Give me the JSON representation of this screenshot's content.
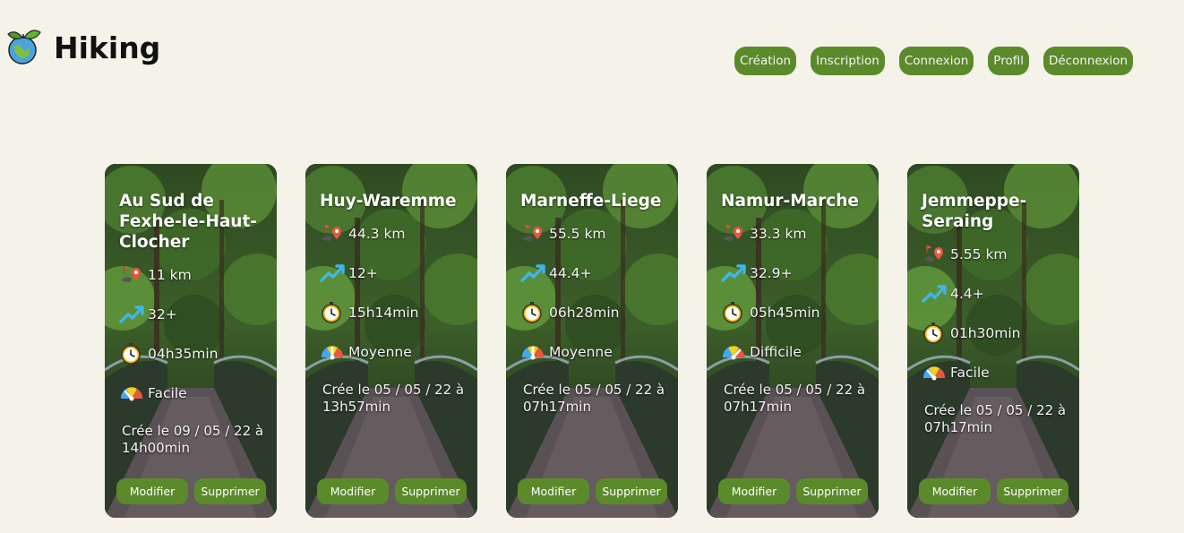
{
  "app": {
    "title": "Hiking"
  },
  "nav": [
    "Création",
    "Inscription",
    "Connexion",
    "Profil",
    "Déconnexion"
  ],
  "actions": {
    "edit": "Modifier",
    "delete": "Supprimer"
  },
  "hikes": [
    {
      "title": "Au Sud de Fexhe-le-Haut-Clocher",
      "distance": "11 km",
      "elevation": "32+",
      "duration": "04h35min",
      "difficulty": "Facile",
      "difficulty_level": "easy",
      "created": "Crée le 09 / 05 / 22 à 14h00min"
    },
    {
      "title": "Huy-Waremme",
      "distance": "44.3 km",
      "elevation": "12+",
      "duration": "15h14min",
      "difficulty": "Moyenne",
      "difficulty_level": "medium",
      "created": "Crée le 05 / 05 / 22 à 13h57min"
    },
    {
      "title": "Marneffe-Liege",
      "distance": "55.5 km",
      "elevation": "44.4+",
      "duration": "06h28min",
      "difficulty": "Moyenne",
      "difficulty_level": "medium",
      "created": "Crée le 05 / 05 / 22 à 07h17min"
    },
    {
      "title": "Namur-Marche",
      "distance": "33.3 km",
      "elevation": "32.9+",
      "duration": "05h45min",
      "difficulty": "Difficile",
      "difficulty_level": "hard",
      "created": "Crée le 05 / 05 / 22 à 07h17min"
    },
    {
      "title": "Jemmeppe-Seraing",
      "distance": "5.55 km",
      "elevation": "4.4+",
      "duration": "01h30min",
      "difficulty": "Facile",
      "difficulty_level": "easy",
      "created": "Crée le 05 / 05 / 22 à 07h17min"
    }
  ],
  "colors": {
    "accent": "#5b8a2b",
    "background": "#f5f2ea"
  },
  "icons": {
    "logo": "globe-leaves-icon",
    "distance": "map-pin-icon",
    "elevation": "trend-up-icon",
    "duration": "stopwatch-icon",
    "difficulty": "gauge-icon"
  }
}
